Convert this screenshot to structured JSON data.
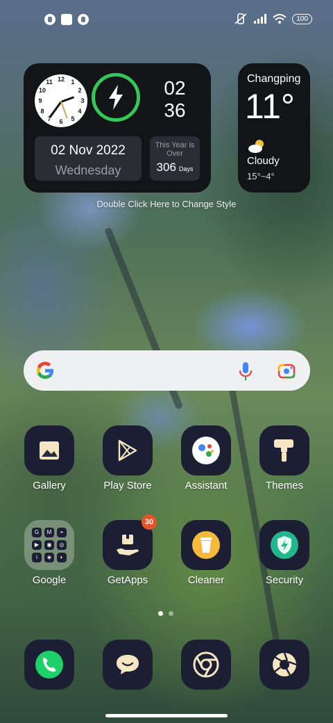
{
  "status": {
    "battery": "100"
  },
  "clock_widget": {
    "hour": "02",
    "minute": "36",
    "date": "02 Nov 2022",
    "weekday": "Wednesday",
    "year_over_label": "This Year is Over",
    "days_count": "306",
    "days_unit": "Days"
  },
  "hint": "Double Click Here to Change Style",
  "weather": {
    "city": "Changping",
    "temp": "11°",
    "condition": "Cloudy",
    "range": "15°~4°",
    "icon": "cloudy-sun-icon"
  },
  "apps_row1": [
    {
      "label": "Gallery",
      "icon": "gallery-icon"
    },
    {
      "label": "Play Store",
      "icon": "play-store-icon"
    },
    {
      "label": "Assistant",
      "icon": "assistant-icon"
    },
    {
      "label": "Themes",
      "icon": "themes-icon"
    }
  ],
  "apps_row2": [
    {
      "label": "Google",
      "icon": "google-folder-icon"
    },
    {
      "label": "GetApps",
      "icon": "getapps-icon",
      "badge": "30"
    },
    {
      "label": "Cleaner",
      "icon": "cleaner-icon"
    },
    {
      "label": "Security",
      "icon": "security-icon"
    }
  ],
  "folder_apps": [
    "G",
    "M",
    "⌖",
    "▶",
    "◉",
    "◎",
    "i",
    "◈",
    "◐"
  ],
  "dock": [
    {
      "icon": "phone-icon"
    },
    {
      "icon": "messages-icon"
    },
    {
      "icon": "chrome-icon"
    },
    {
      "icon": "camera-icon"
    }
  ],
  "colors": {
    "accent_green": "#34c759",
    "tile_bg": "#1c1f33",
    "badge_red": "#e5532b"
  }
}
